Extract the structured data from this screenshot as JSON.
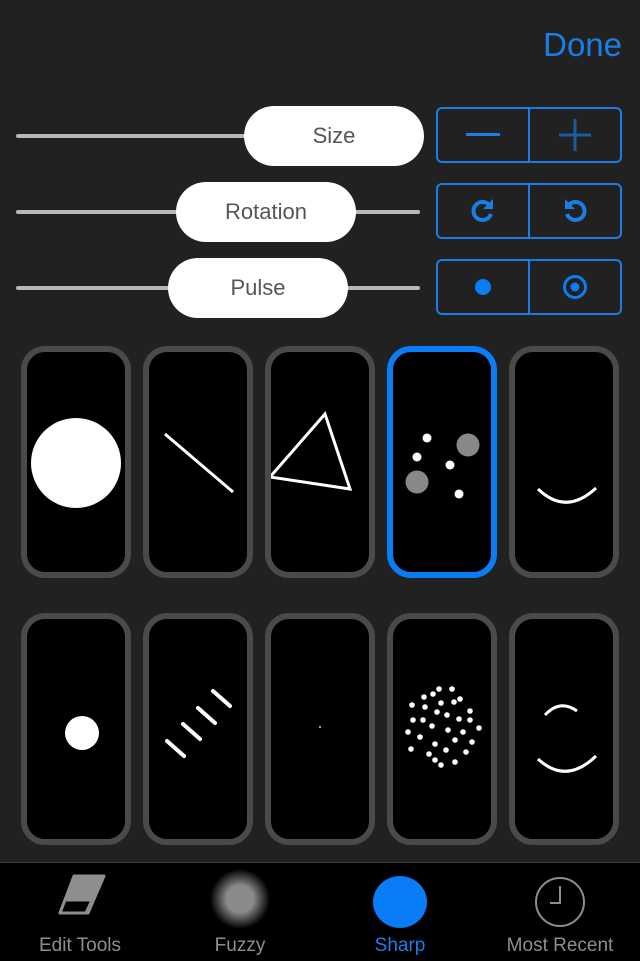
{
  "header": {
    "done_label": "Done"
  },
  "controls": {
    "accent_color": "#1a7ee6",
    "sliders": [
      {
        "label": "Size",
        "value_fraction": 0.85
      },
      {
        "label": "Rotation",
        "value_fraction": 0.56
      },
      {
        "label": "Pulse",
        "value_fraction": 0.54
      }
    ],
    "segments": [
      {
        "left_icon": "minus-icon",
        "right_icon": "plus-icon",
        "right_disabled": true
      },
      {
        "left_icon": "rotate-clockwise-icon",
        "right_icon": "rotate-counterclockwise-icon"
      },
      {
        "left_icon": "dot-icon",
        "right_icon": "ring-dot-icon"
      }
    ]
  },
  "brushes": {
    "selected_index": 3,
    "items": [
      {
        "name": "solid-circle"
      },
      {
        "name": "line"
      },
      {
        "name": "triangle"
      },
      {
        "name": "scattered-dots"
      },
      {
        "name": "arc"
      },
      {
        "name": "small-dot"
      },
      {
        "name": "dashes"
      },
      {
        "name": "tiny-speck"
      },
      {
        "name": "dot-cloud"
      },
      {
        "name": "double-arc"
      }
    ]
  },
  "tabbar": {
    "active_index": 2,
    "tabs": [
      {
        "label": "Edit Tools",
        "icon": "eraser-icon"
      },
      {
        "label": "Fuzzy",
        "icon": "fuzzy-brush-icon"
      },
      {
        "label": "Sharp",
        "icon": "sharp-brush-icon"
      },
      {
        "label": "Most Recent",
        "icon": "clock-icon"
      }
    ]
  }
}
